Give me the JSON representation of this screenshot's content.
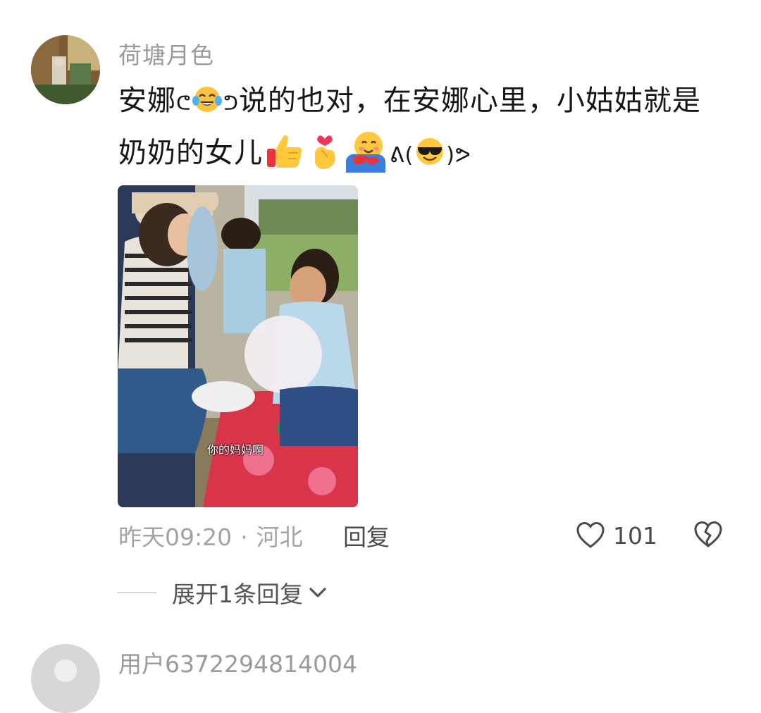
{
  "comment": {
    "username": "荷塘月色",
    "content_line1_prefix": "安娜",
    "content_line1_suffix": "说的也对，在安娜心里，小姑姑就是",
    "content_line2_text": "奶奶的女儿",
    "emojis": [
      "tears-of-joy-emoji",
      "thumbs-up-emoji",
      "finger-heart-emoji",
      "hugging-face-emoji",
      "sunglasses-face-emoji"
    ],
    "photo_subtitle": "你的妈妈啊",
    "time": "昨天09:20",
    "separator": "·",
    "location": "河北",
    "reply_label": "回复",
    "like_count": "101",
    "expand_label": "展开1条回复"
  },
  "next_comment": {
    "username": "用户6372294814004"
  },
  "colors": {
    "username_gray": "#9a9a9a",
    "text_black": "#161616",
    "meta_gray": "#a3a3a3",
    "action_gray": "#4a4a4a"
  }
}
